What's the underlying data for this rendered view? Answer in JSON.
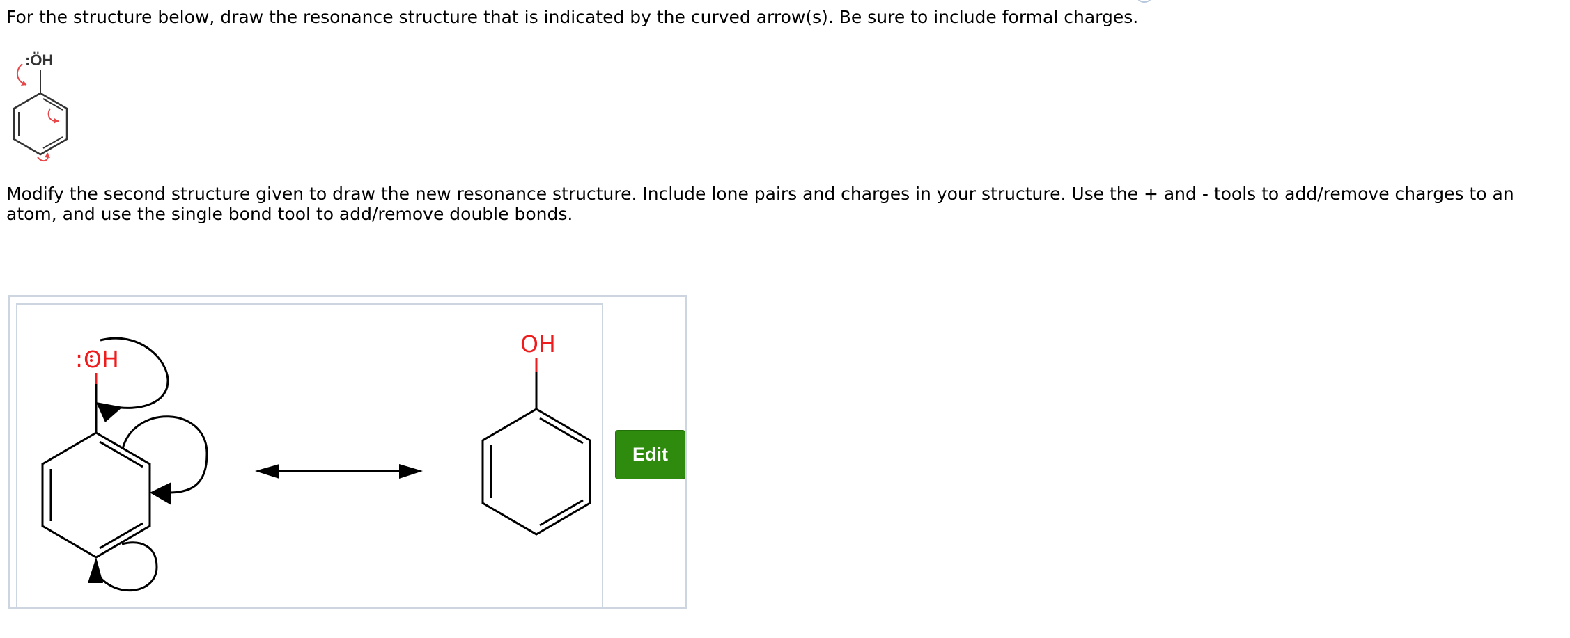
{
  "question": {
    "prompt": "For the structure below, draw the resonance structure that is indicated by the curved arrow(s). Be sure to include formal charges.",
    "instructions": "Modify the second structure given to draw the new resonance structure. Include lone pairs and charges in your structure. Use the + and - tools to add/remove charges to an atom, and use the single bond tool to add/remove double bonds."
  },
  "thumbnail": {
    "group_label": ":ÖH"
  },
  "sketcher": {
    "left_molecule": {
      "lone_pair": ":",
      "oh_label": "OH"
    },
    "right_molecule": {
      "oh_label": "OH"
    },
    "edit_button": "Edit"
  },
  "colors": {
    "oxygen": "#ee1c1c",
    "curved_arrow_thumb": "#e8474a",
    "edit_button": "#2e8b0e",
    "frame_border": "#cdd5e0"
  }
}
